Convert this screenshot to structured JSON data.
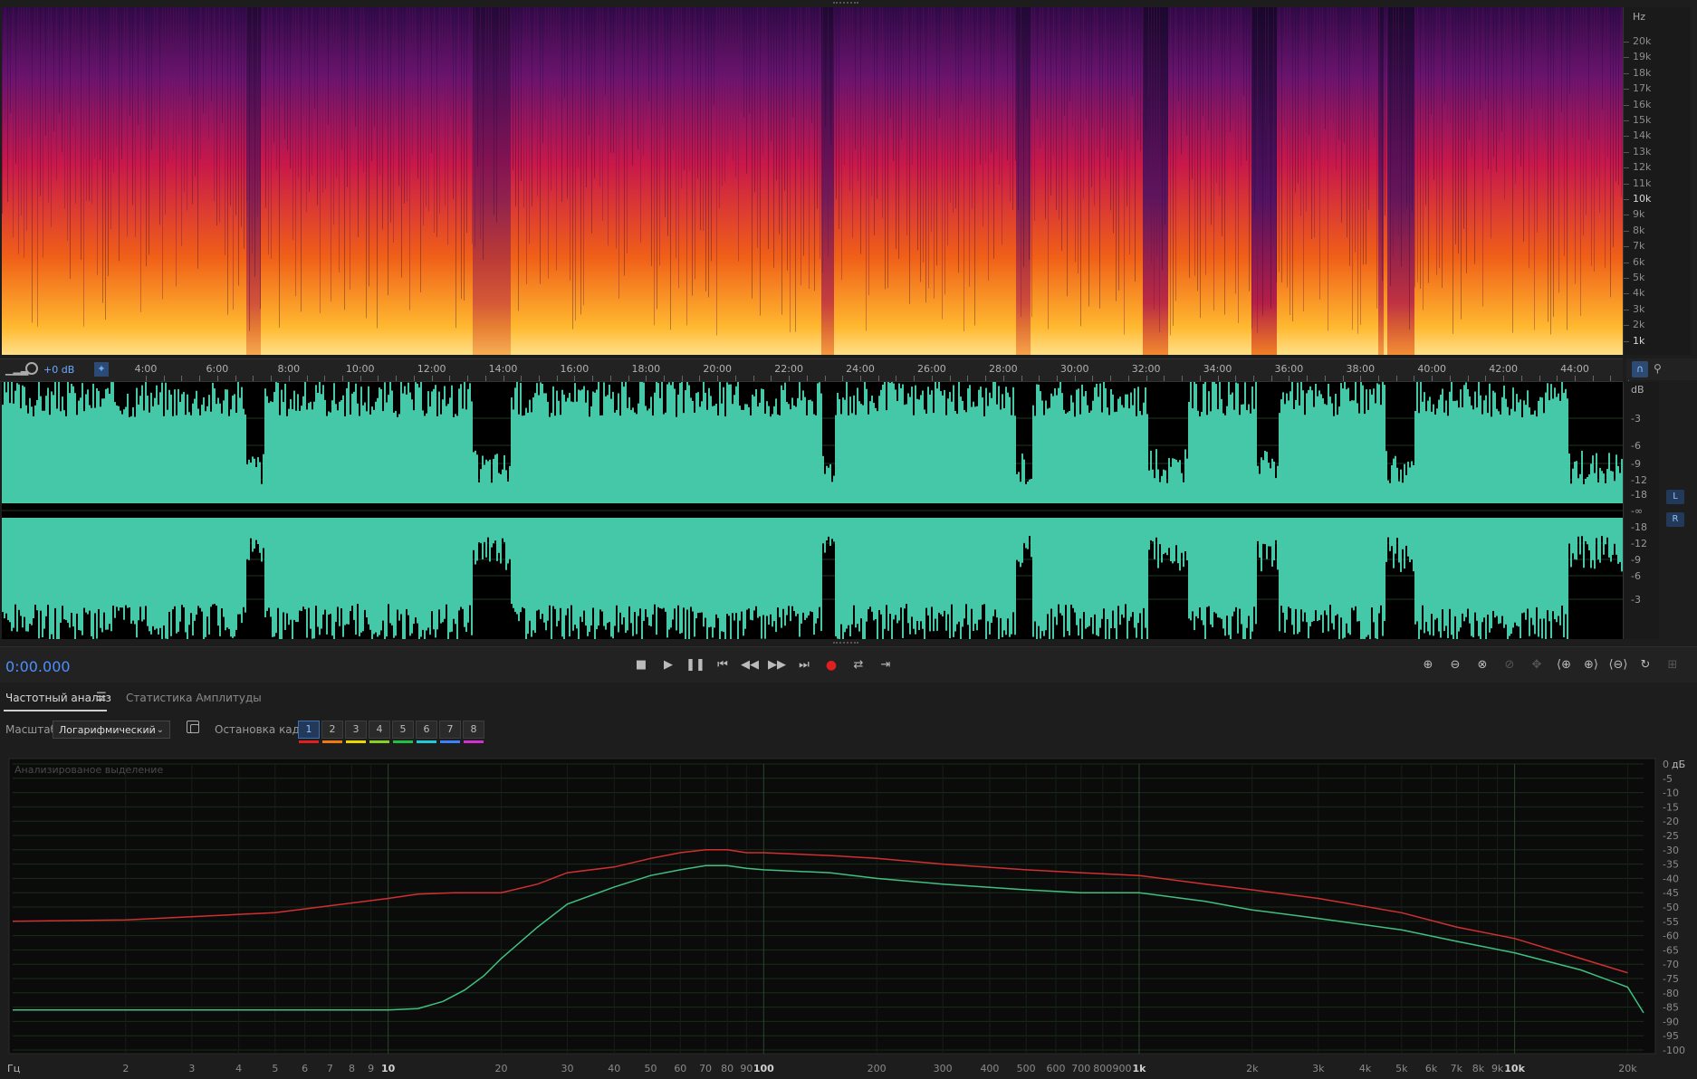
{
  "spectral": {
    "hz_unit": "Hz",
    "hz_ticks": [
      "20k",
      "19k",
      "18k",
      "17k",
      "16k",
      "15k",
      "14k",
      "13k",
      "12k",
      "11k",
      "10k",
      "9k",
      "8k",
      "7k",
      "6k",
      "5k",
      "4k",
      "3k",
      "2k",
      "1k"
    ]
  },
  "timeline": {
    "gain": "+0 dB",
    "ticks": [
      "4:00",
      "6:00",
      "8:00",
      "10:00",
      "12:00",
      "14:00",
      "16:00",
      "18:00",
      "20:00",
      "22:00",
      "24:00",
      "26:00",
      "28:00",
      "30:00",
      "32:00",
      "34:00",
      "36:00",
      "38:00",
      "40:00",
      "42:00",
      "44:00"
    ]
  },
  "waveform": {
    "db_unit": "dB",
    "db_ticks": [
      "-3",
      "-6",
      "-9",
      "-12",
      "-18",
      "-∞",
      "-18",
      "-12",
      "-9",
      "-6",
      "-3"
    ],
    "channels": [
      "L",
      "R"
    ],
    "color": "#45c8a8"
  },
  "transport": {
    "time": "0:00.000",
    "buttons": [
      "stop-icon",
      "play-icon",
      "pause-icon",
      "skip-back-icon",
      "rewind-icon",
      "fast-forward-icon",
      "skip-forward-icon",
      "record-icon",
      "loop-icon",
      "skip-silence-icon"
    ],
    "zoom_buttons": [
      "zoom-in-amplitude-icon",
      "zoom-out-amplitude-icon",
      "zoom-selection-icon",
      "zoom-disabled-icon",
      "zoom-disabled-2-icon",
      "zoom-in-left-icon",
      "zoom-in-right-icon",
      "zoom-out-full-icon",
      "zoom-reset-icon",
      "zoom-extra-icon"
    ]
  },
  "panel": {
    "tabs": [
      "Частотный анализ",
      "Статистика Амплитуды"
    ],
    "scale_label": "Масштаб:",
    "scale_value": "Логарифмический",
    "hold_label": "Остановка кадра:",
    "hold_buttons": [
      "1",
      "2",
      "3",
      "4",
      "5",
      "6",
      "7",
      "8"
    ],
    "hold_colors": [
      "#e02020",
      "#f07a10",
      "#e8d800",
      "#8ad020",
      "#20c040",
      "#20c8d8",
      "#3a80ff",
      "#d030d0"
    ]
  },
  "chart_data": {
    "type": "line",
    "annotation": "Анализированое выделение",
    "x_unit": "Гц",
    "y_unit": "дБ",
    "x_scale": "log",
    "xlim": [
      1,
      22050
    ],
    "ylim": [
      -100,
      0
    ],
    "x_ticks": [
      "2",
      "3",
      "4",
      "5",
      "6",
      "7",
      "8",
      "9",
      "10",
      "20",
      "30",
      "40",
      "50",
      "60",
      "70",
      "80",
      "90",
      "100",
      "200",
      "300",
      "400",
      "500",
      "600",
      "700",
      "800",
      "900",
      "1k",
      "2k",
      "3k",
      "4k",
      "5k",
      "6k",
      "7k",
      "8k",
      "9k",
      "10k",
      "20k"
    ],
    "y_ticks": [
      "0",
      "-5",
      "-10",
      "-15",
      "-20",
      "-25",
      "-30",
      "-35",
      "-40",
      "-45",
      "-50",
      "-55",
      "-60",
      "-65",
      "-70",
      "-75",
      "-80",
      "-85",
      "-90",
      "-95",
      "-100"
    ],
    "series": [
      {
        "color": "#d03030",
        "x": [
          1,
          2,
          5,
          10,
          12,
          15,
          20,
          25,
          30,
          40,
          50,
          60,
          70,
          80,
          90,
          100,
          150,
          200,
          300,
          500,
          700,
          1000,
          1500,
          2000,
          3000,
          5000,
          7000,
          10000,
          15000,
          20000
        ],
        "y": [
          -55,
          -54.5,
          -52,
          -47,
          -45.5,
          -45,
          -45,
          -42,
          -38,
          -36,
          -33,
          -31,
          -30,
          -30,
          -31,
          -31,
          -32,
          -33,
          -35,
          -37,
          -38,
          -39,
          -42,
          -44,
          -47,
          -52,
          -57,
          -61,
          -68,
          -73
        ]
      },
      {
        "color": "#40c080",
        "x": [
          1,
          2,
          5,
          9,
          10,
          12,
          14,
          16,
          18,
          20,
          25,
          30,
          40,
          50,
          60,
          70,
          80,
          90,
          100,
          150,
          200,
          300,
          500,
          700,
          1000,
          1500,
          2000,
          3000,
          5000,
          7000,
          10000,
          15000,
          20000,
          22050
        ],
        "y": [
          -86,
          -86,
          -86,
          -86,
          -86,
          -85.5,
          -83,
          -79,
          -74,
          -68,
          -57,
          -49,
          -43,
          -39,
          -37,
          -35.5,
          -35.5,
          -36.5,
          -37,
          -38,
          -40,
          -42,
          -44,
          -45,
          -45,
          -48,
          -51,
          -54,
          -58,
          -62,
          -66,
          -72,
          -78,
          -87
        ]
      }
    ]
  }
}
